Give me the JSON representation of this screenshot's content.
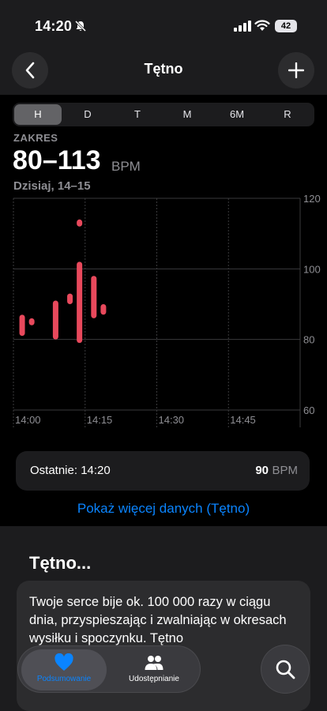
{
  "status_bar": {
    "time": "14:20",
    "battery": "42"
  },
  "nav": {
    "title": "Tętno"
  },
  "segments": [
    "H",
    "D",
    "T",
    "M",
    "6M",
    "R"
  ],
  "segment_active": "H",
  "range": {
    "label": "ZAKRES",
    "value": "80–113",
    "unit": "BPM",
    "date": "Dzisiaj, 14–15"
  },
  "chart_data": {
    "type": "range-bar",
    "x_ticks": [
      "14:00",
      "14:15",
      "14:30",
      "14:45"
    ],
    "x_range": [
      "14:00",
      "15:00"
    ],
    "y_ticks": [
      60,
      80,
      100,
      120
    ],
    "ylim": [
      60,
      120
    ],
    "series": [
      {
        "color": "#e8495c",
        "points": [
          {
            "t": "14:01",
            "min": 81,
            "max": 87
          },
          {
            "t": "14:03",
            "min": 84,
            "max": 86
          },
          {
            "t": "14:08",
            "min": 80,
            "max": 91
          },
          {
            "t": "14:11",
            "min": 90,
            "max": 93
          },
          {
            "t": "14:13",
            "min": 79,
            "max": 102
          },
          {
            "t": "14:13",
            "min": 112,
            "max": 114
          },
          {
            "t": "14:16",
            "min": 86,
            "max": 98
          },
          {
            "t": "14:18",
            "min": 87,
            "max": 90
          }
        ]
      }
    ]
  },
  "latest": {
    "label": "Ostatnie: 14:20",
    "value": "90",
    "unit": "BPM"
  },
  "more_link": "Pokaż więcej danych (Tętno)",
  "about": {
    "title": "Tętno...",
    "text": "Twoje serce bije ok. 100 000 razy w ciągu dnia, przyspieszając i zwalniając w okresach wysiłku i spoczynku. Tętno"
  },
  "tabs": [
    {
      "label": "Podsumowanie",
      "icon": "heart-icon"
    },
    {
      "label": "Udostępnianie",
      "icon": "people-icon"
    }
  ],
  "colors": {
    "accent": "#0a84ff",
    "heart_rate": "#e8495c"
  }
}
